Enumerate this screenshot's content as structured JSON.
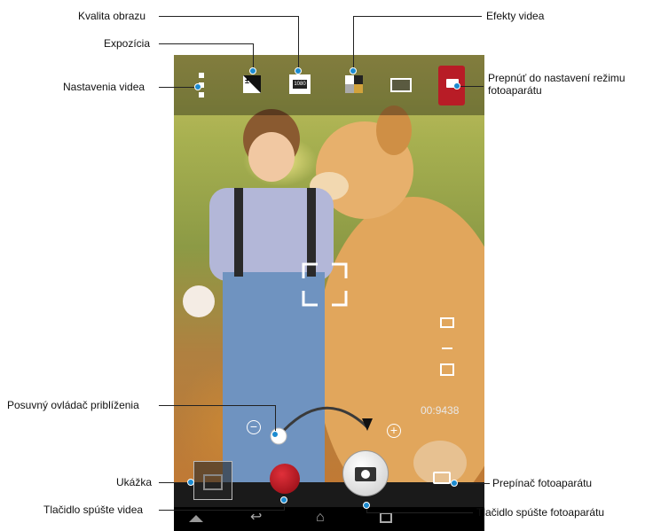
{
  "callouts": {
    "kvalita_obrazu": "Kvalita obrazu",
    "expozicia": "Expozícia",
    "nastavenia_videa": "Nastavenia videa",
    "efekty_videa": "Efekty videa",
    "prepnut_line1": "Prepnúť do nastavení režimu",
    "prepnut_line2": "fotoaparátu",
    "posuvny_ovladac": "Posuvný ovládač priblíženia",
    "ukazka": "Ukážka",
    "tlacidlo_videa": "Tlačidlo spúšte videa",
    "prepinac": "Prepínač fotoaparátu",
    "tlacidlo_fotoaparatu": "Tlačidlo spúšte fotoaparátu"
  },
  "screen": {
    "storage_count": "9438",
    "storage_prefix": "00:",
    "resolution_badge": "1080"
  },
  "icons": {
    "settings": "vertical-dots-icon",
    "exposure": "exposure-icon",
    "quality": "film-quality-icon",
    "effects": "effects-icon",
    "battery": "battery-icon",
    "mode": "camera-mode-icon",
    "shutter": "camera-shutter-icon",
    "record": "record-icon",
    "switch": "camera-switch-icon",
    "zoom_in": "zoom-in-icon",
    "zoom_out": "zoom-out-icon",
    "nav_back": "back-icon",
    "nav_home": "home-icon",
    "nav_recent": "recent-apps-icon",
    "nav_up": "menu-up-icon"
  },
  "colors": {
    "callout_line": "#222222",
    "callout_dot": "#1c8bd0",
    "mode_button": "#b81c26",
    "record_button": "#b5121b"
  }
}
